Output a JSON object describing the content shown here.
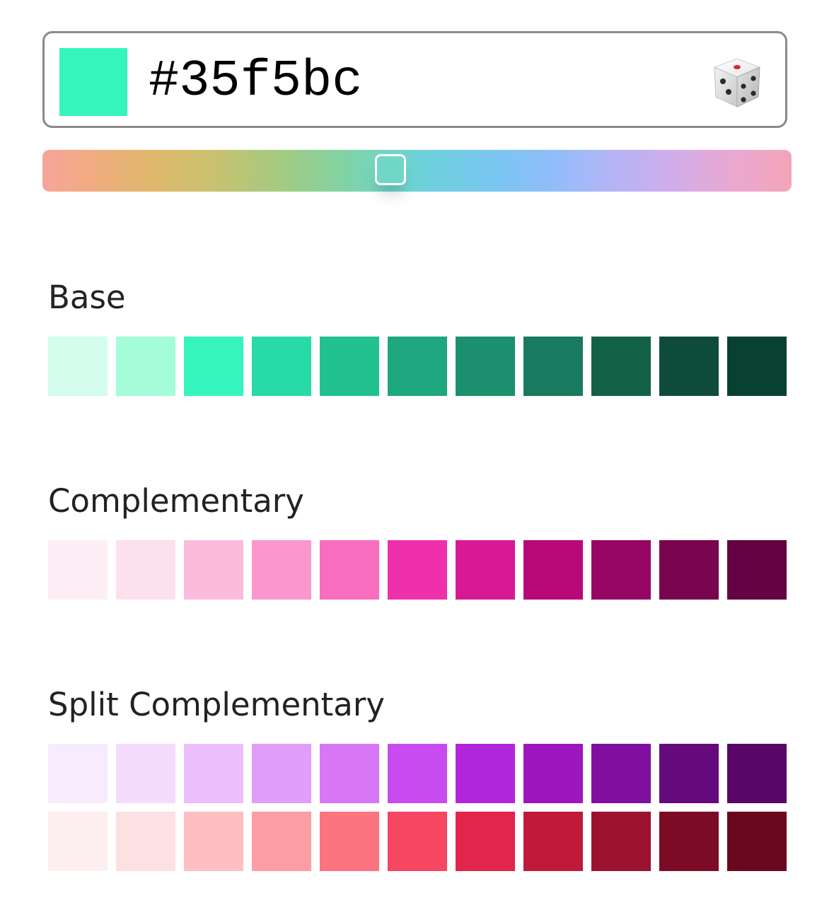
{
  "picker": {
    "hex": "#35f5bc",
    "preview_color": "#35f5bc",
    "randomize_icon": "dice-icon",
    "hue_handle_fraction": 0.465,
    "hue_handle_color": "#70d6c6"
  },
  "sections": {
    "base": {
      "title": "Base",
      "colors": [
        "#d4fded",
        "#a5fcd9",
        "#35f5bc",
        "#27daa8",
        "#22c190",
        "#1ea77f",
        "#1b8f6e",
        "#187a5f",
        "#136248",
        "#0f4b3b",
        "#084132"
      ]
    },
    "complementary": {
      "title": "Complementary",
      "colors": [
        "#fdeef5",
        "#fde0ee",
        "#fbbbdc",
        "#fa97ce",
        "#f96dbf",
        "#f02fab",
        "#d81994",
        "#b7097a",
        "#960764",
        "#78054e",
        "#640342"
      ]
    },
    "split": {
      "title": "Split Complementary",
      "purple": [
        "#f8ebfe",
        "#f3dcfb",
        "#ecbefb",
        "#e29cf9",
        "#d877f6",
        "#c84bf0",
        "#b226db",
        "#9d16bd",
        "#800e9e",
        "#650a7c",
        "#590668"
      ],
      "red": [
        "#fdeef0",
        "#fde0e2",
        "#fdbfc2",
        "#fc9ea3",
        "#fb7480",
        "#f54662",
        "#e2254b",
        "#c01a3b",
        "#9c1231",
        "#7c0c25",
        "#6b0820"
      ]
    }
  }
}
